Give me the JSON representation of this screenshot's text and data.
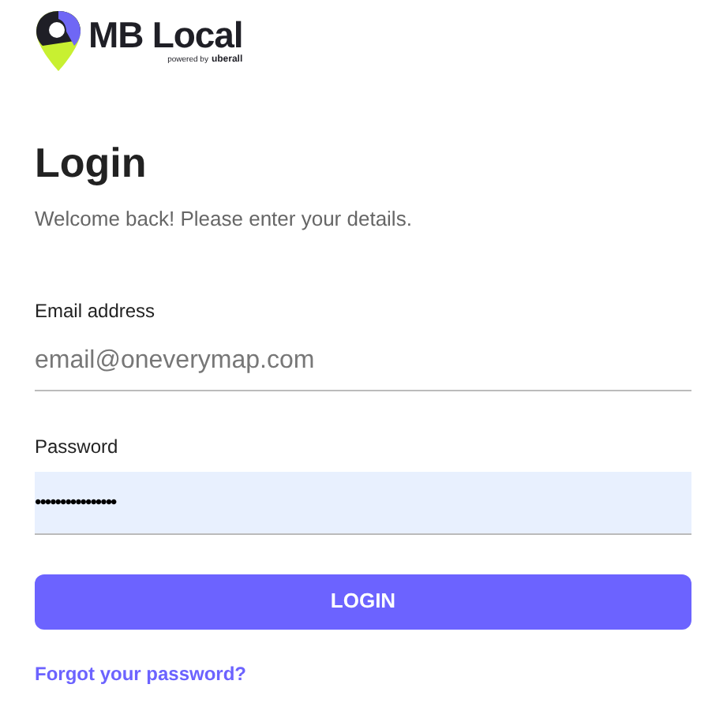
{
  "logo": {
    "name": "MB Local",
    "tagline": "powered by",
    "partner": "uberall"
  },
  "heading": "Login",
  "subtitle": "Welcome back! Please enter your details.",
  "email": {
    "label": "Email address",
    "placeholder": "email@oneverymap.com"
  },
  "password": {
    "label": "Password",
    "value": "••••••••••••••••",
    "autofilled": true
  },
  "button": "LOGIN",
  "forgot_link": "Forgot your password?"
}
